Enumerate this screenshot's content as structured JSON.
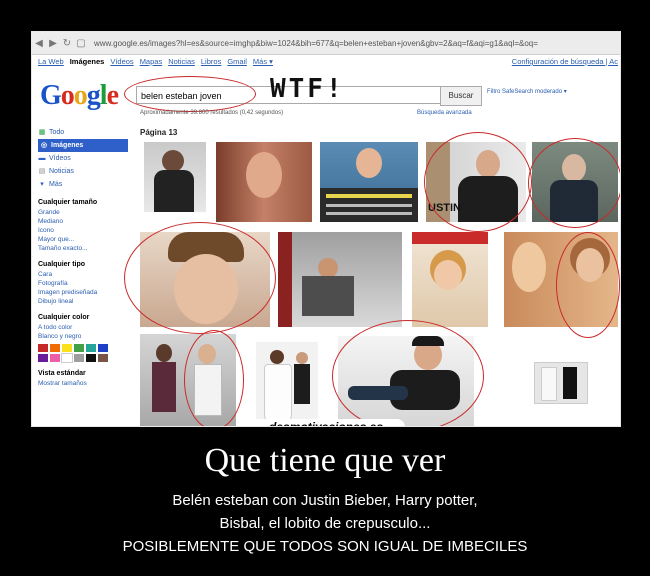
{
  "browser": {
    "url": "www.google.es/images?hl=es&source=imghp&biw=1024&bih=677&q=belen+esteban+joven&gbv=2&aq=f&aqi=g1&aql=&oq="
  },
  "gbar": {
    "items": [
      "La Web",
      "Imágenes",
      "Vídeos",
      "Mapas",
      "Noticias",
      "Libros",
      "Gmail",
      "Más ▾"
    ],
    "settings": "Configuración de búsqueda | Ac"
  },
  "search": {
    "query": "belen esteban joven",
    "button": "Buscar",
    "safesearch": "Filtro SafeSearch moderado ▾",
    "advanced": "Búsqueda avanzada",
    "stats": "Aproximadamente 39.800 resultados (0,42 segundos)"
  },
  "annotation": {
    "text": "WTF!"
  },
  "sidebar": {
    "nav": [
      {
        "label": "Todo",
        "icon": "grid-icon"
      },
      {
        "label": "Imágenes",
        "icon": "camera-icon"
      },
      {
        "label": "Vídeos",
        "icon": "video-icon"
      },
      {
        "label": "Noticias",
        "icon": "news-icon"
      },
      {
        "label": "Más",
        "icon": "more-icon"
      }
    ],
    "size_head": "Cualquier tamaño",
    "size_opts": [
      "Grande",
      "Mediano",
      "Icono",
      "Mayor que...",
      "Tamaño exacto..."
    ],
    "type_head": "Cualquier tipo",
    "type_opts": [
      "Cara",
      "Fotografía",
      "Imagen prediseñada",
      "Dibujo lineal"
    ],
    "color_head": "Cualquier color",
    "color_opts": [
      "A todo color",
      "Blanco y negro"
    ],
    "view_head": "Vista estándar",
    "view_opts": [
      "Mostrar tamaños"
    ]
  },
  "page": {
    "label": "Página 13"
  },
  "colors": {
    "swatches": [
      "#c62828",
      "#ef6c00",
      "#f9e11e",
      "#43a047",
      "#26a69a",
      "#1e40c9",
      "#6a1b9a",
      "#ec5fa8",
      "#ffffff",
      "#9e9e9e",
      "#111111",
      "#795548"
    ]
  },
  "watermark": "desmotivaciones.es",
  "caption": {
    "title": "Que tiene que ver",
    "line1": "Belén esteban con Justin Bieber, Harry potter,",
    "line2": "Bisbal, el lobito de crepusculo...",
    "line3": "POSIBLEMENTE QUE TODOS SON IGUAL DE IMBECILES"
  }
}
